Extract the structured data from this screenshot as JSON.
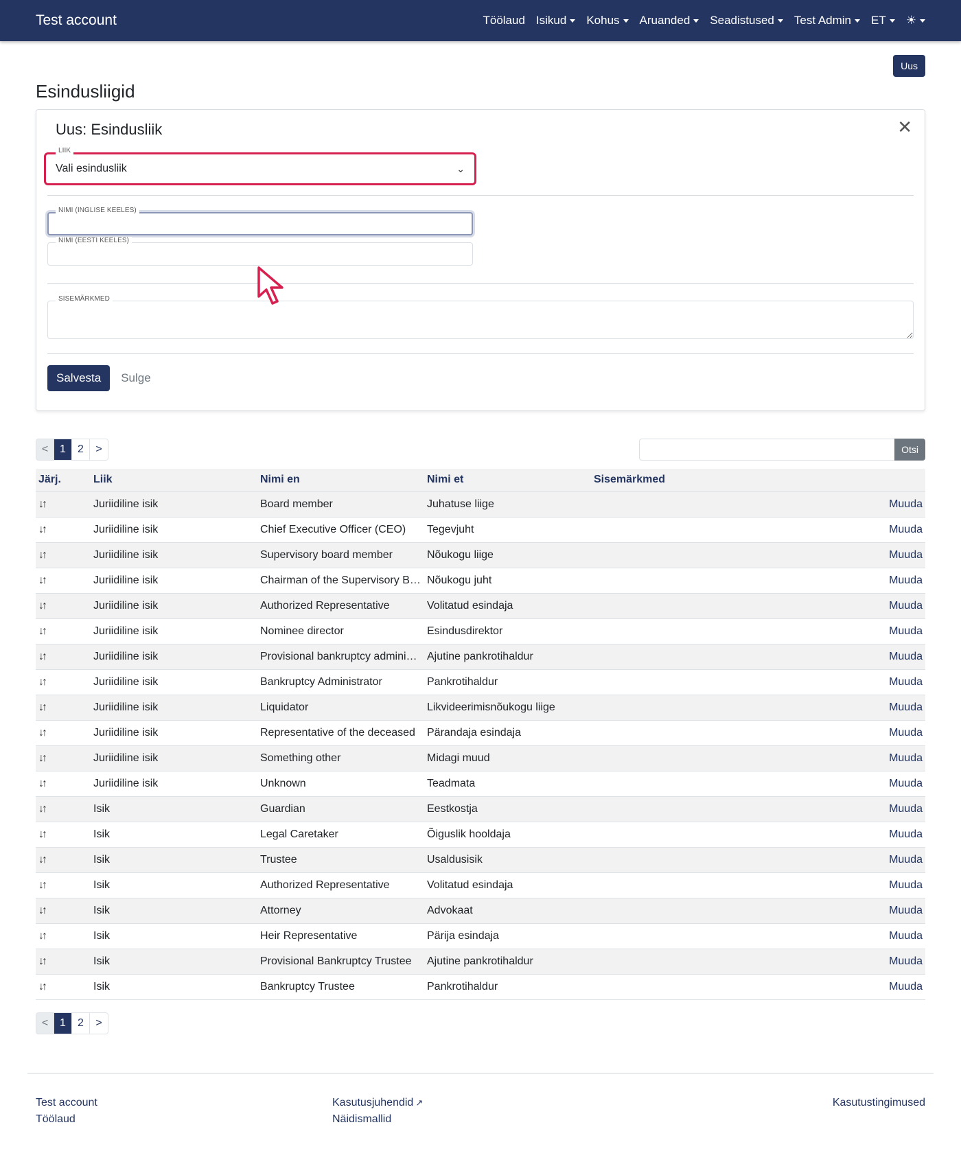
{
  "navbar": {
    "brand": "Test account",
    "items": [
      {
        "label": "Töölaud",
        "dropdown": false
      },
      {
        "label": "Isikud",
        "dropdown": true
      },
      {
        "label": "Kohus",
        "dropdown": true
      },
      {
        "label": "Aruanded",
        "dropdown": true
      },
      {
        "label": "Seadistused",
        "dropdown": true
      },
      {
        "label": "Test Admin",
        "dropdown": true
      },
      {
        "label": "ET",
        "dropdown": true
      }
    ],
    "theme_icon": "☀"
  },
  "page": {
    "new_button": "Uus",
    "title": "Esindusliigid"
  },
  "form": {
    "title": "Uus: Esindusliik",
    "type_label": "Liik",
    "type_value": "Vali esindusliik",
    "name_en_label": "Nimi (inglise keeles)",
    "name_en_value": "",
    "name_et_label": "Nimi (eesti keeles)",
    "name_et_value": "",
    "notes_label": "Sisemärkmed",
    "notes_value": "",
    "save": "Salvesta",
    "close": "Sulge"
  },
  "pagination": {
    "prev": "<",
    "pages": [
      "1",
      "2"
    ],
    "next": ">",
    "active": "1"
  },
  "search": {
    "placeholder": "",
    "button": "Otsi"
  },
  "table": {
    "headers": [
      "Järj.",
      "Liik",
      "Nimi en",
      "Nimi et",
      "Sisemärkmed",
      ""
    ],
    "edit_label": "Muuda",
    "rows": [
      {
        "type": "Juriidiline isik",
        "name_en": "Board member",
        "name_et": "Juhatuse liige",
        "notes": ""
      },
      {
        "type": "Juriidiline isik",
        "name_en": "Chief Executive Officer (CEO)",
        "name_et": "Tegevjuht",
        "notes": ""
      },
      {
        "type": "Juriidiline isik",
        "name_en": "Supervisory board member",
        "name_et": "Nõukogu liige",
        "notes": ""
      },
      {
        "type": "Juriidiline isik",
        "name_en": "Chairman of the Supervisory B…",
        "name_et": "Nõukogu juht",
        "notes": ""
      },
      {
        "type": "Juriidiline isik",
        "name_en": "Authorized Representative",
        "name_et": "Volitatud esindaja",
        "notes": ""
      },
      {
        "type": "Juriidiline isik",
        "name_en": "Nominee director",
        "name_et": "Esindusdirektor",
        "notes": ""
      },
      {
        "type": "Juriidiline isik",
        "name_en": "Provisional bankruptcy admini…",
        "name_et": "Ajutine pankrotihaldur",
        "notes": ""
      },
      {
        "type": "Juriidiline isik",
        "name_en": "Bankruptcy Administrator",
        "name_et": "Pankrotihaldur",
        "notes": ""
      },
      {
        "type": "Juriidiline isik",
        "name_en": "Liquidator",
        "name_et": "Likvideerimisnõukogu liige",
        "notes": ""
      },
      {
        "type": "Juriidiline isik",
        "name_en": "Representative of the deceased",
        "name_et": "Pärandaja esindaja",
        "notes": ""
      },
      {
        "type": "Juriidiline isik",
        "name_en": "Something other",
        "name_et": "Midagi muud",
        "notes": ""
      },
      {
        "type": "Juriidiline isik",
        "name_en": "Unknown",
        "name_et": "Teadmata",
        "notes": ""
      },
      {
        "type": "Isik",
        "name_en": "Guardian",
        "name_et": "Eestkostja",
        "notes": ""
      },
      {
        "type": "Isik",
        "name_en": "Legal Caretaker",
        "name_et": "Õiguslik hooldaja",
        "notes": ""
      },
      {
        "type": "Isik",
        "name_en": "Trustee",
        "name_et": "Usaldusisik",
        "notes": ""
      },
      {
        "type": "Isik",
        "name_en": "Authorized Representative",
        "name_et": "Volitatud esindaja",
        "notes": ""
      },
      {
        "type": "Isik",
        "name_en": "Attorney",
        "name_et": "Advokaat",
        "notes": ""
      },
      {
        "type": "Isik",
        "name_en": "Heir Representative",
        "name_et": "Pärija esindaja",
        "notes": ""
      },
      {
        "type": "Isik",
        "name_en": "Provisional Bankruptcy Trustee",
        "name_et": "Ajutine pankrotihaldur",
        "notes": ""
      },
      {
        "type": "Isik",
        "name_en": "Bankruptcy Trustee",
        "name_et": "Pankrotihaldur",
        "notes": ""
      }
    ]
  },
  "footer": {
    "col1": [
      "Test account",
      "Töölaud"
    ],
    "col2": [
      "Kasutusjuhendid",
      "Näidismallid"
    ],
    "col3": [
      "Kasutustingimused"
    ]
  },
  "colors": {
    "primary": "#233560",
    "highlight": "#d6204f",
    "secondary": "#6c757d"
  }
}
